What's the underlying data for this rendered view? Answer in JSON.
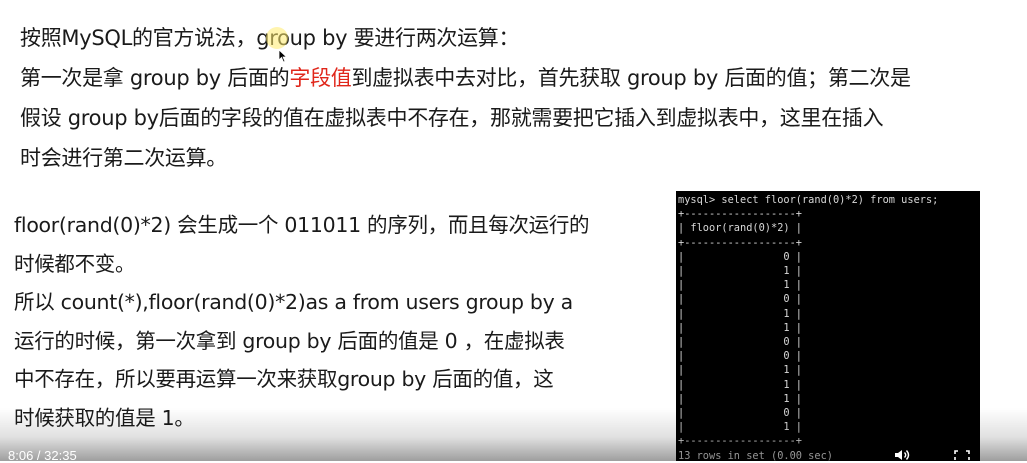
{
  "slide": {
    "top_lines": [
      [
        "按照MySQL的官方说法，group by 要进行两次运算："
      ],
      [
        "第一次是拿 group by 后面的",
        "字段值",
        "到虚拟表中去对比，首先获取 group by 后面的值；第二次是"
      ],
      [
        "假设  group by后面的字段的值在虚拟表中不存在，那就需要把它插入到虚拟表中，这里在插入"
      ],
      [
        "时会进行第二次运算。"
      ]
    ],
    "highlight_color": "#e0261a",
    "left_lines": [
      "floor(rand(0)*2) 会生成一个 011011 的序列，而且每次运行的",
      "时候都不变。",
      "所以 count(*),floor(rand(0)*2)as a from users group by a",
      "运行的时候，第一次拿到 group by 后面的值是 0 ，在虚拟表",
      "中不存在，所以要再运算一次来获取group by 后面的值，这",
      "时候获取的值是 1。"
    ]
  },
  "terminal": {
    "command": "mysql> select floor(rand(0)*2) from users;",
    "border": "+------------------+",
    "header": "| floor(rand(0)*2) |",
    "values": [
      "0",
      "1",
      "1",
      "0",
      "1",
      "1",
      "0",
      "0",
      "1",
      "1",
      "1",
      "0",
      "1"
    ],
    "footer": "13 rows in set (0.00 sec)"
  },
  "player": {
    "time": "8:06 / 32:35",
    "volume_icon": "volume-icon",
    "fullscreen_icon": "fullscreen-icon"
  }
}
